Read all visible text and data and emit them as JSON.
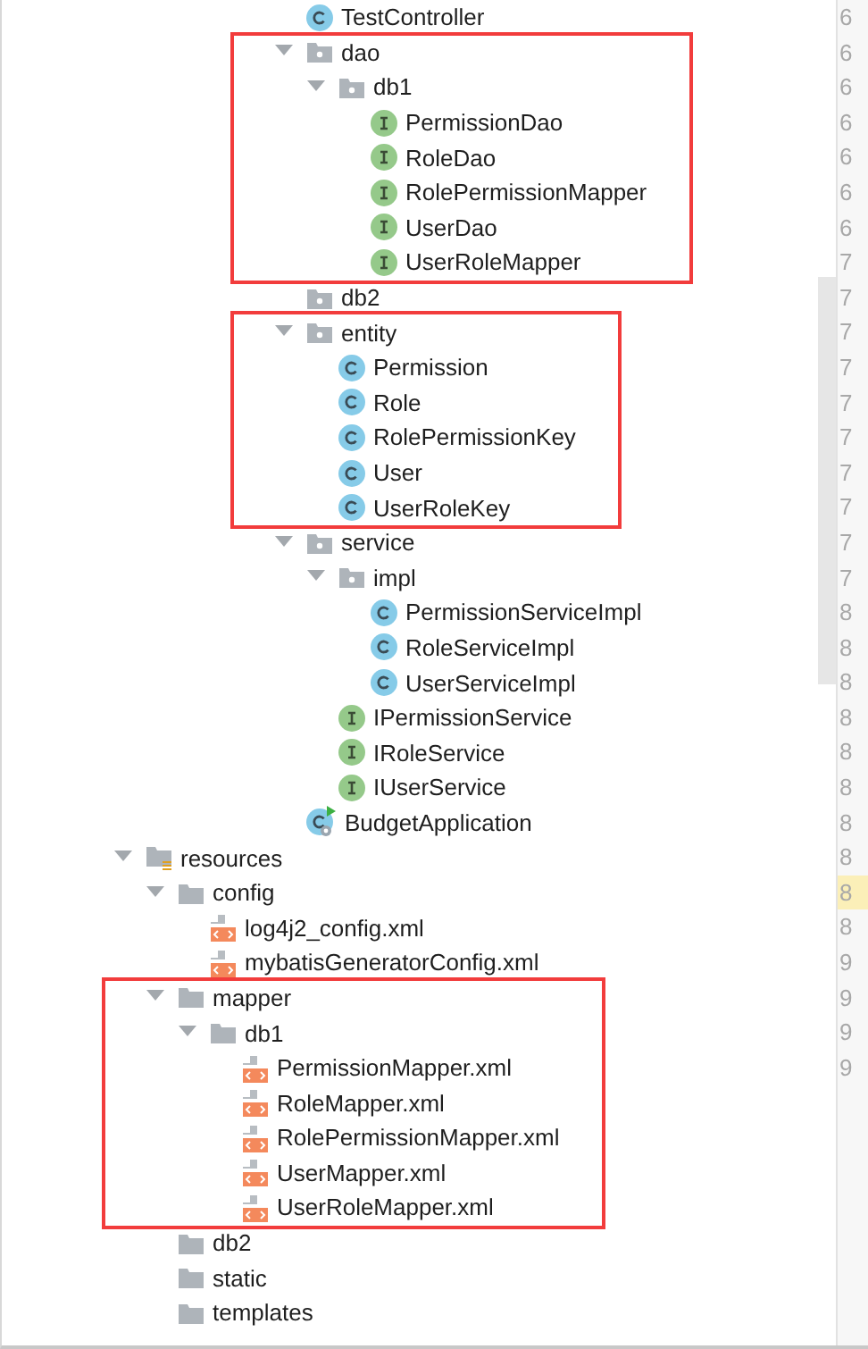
{
  "tree": {
    "package_contents": [
      {
        "children": [
          {
            "name": "TestController",
            "kind": "class"
          }
        ]
      },
      {
        "name": "dao",
        "kind": "package",
        "expanded": true,
        "boxed": true,
        "children": [
          {
            "name": "db1",
            "kind": "package",
            "expanded": true,
            "children": [
              {
                "name": "PermissionDao",
                "kind": "interface"
              },
              {
                "name": "RoleDao",
                "kind": "interface"
              },
              {
                "name": "RolePermissionMapper",
                "kind": "interface"
              },
              {
                "name": "UserDao",
                "kind": "interface"
              },
              {
                "name": "UserRoleMapper",
                "kind": "interface"
              }
            ]
          }
        ]
      },
      {
        "children": [
          {
            "name": "db2",
            "kind": "package"
          }
        ]
      },
      {
        "name": "entity",
        "kind": "package",
        "expanded": true,
        "boxed": true,
        "children": [
          {
            "name": "Permission",
            "kind": "class"
          },
          {
            "name": "Role",
            "kind": "class"
          },
          {
            "name": "RolePermissionKey",
            "kind": "class"
          },
          {
            "name": "User",
            "kind": "class"
          },
          {
            "name": "UserRoleKey",
            "kind": "class"
          }
        ]
      },
      {
        "name": "service",
        "kind": "package",
        "expanded": true,
        "children": [
          {
            "name": "impl",
            "kind": "package",
            "expanded": true,
            "children": [
              {
                "name": "PermissionServiceImpl",
                "kind": "class"
              },
              {
                "name": "RoleServiceImpl",
                "kind": "class"
              },
              {
                "name": "UserServiceImpl",
                "kind": "class"
              }
            ]
          },
          {
            "name": "IPermissionService",
            "kind": "interface"
          },
          {
            "name": "IRoleService",
            "kind": "interface"
          },
          {
            "name": "IUserService",
            "kind": "interface"
          }
        ]
      },
      {
        "name": "BudgetApplication",
        "kind": "application"
      }
    ],
    "nodes": [
      {
        "name": "resources",
        "kind": "resources",
        "expanded": true,
        "children": [
          {
            "name": "config",
            "kind": "folder",
            "expanded": true,
            "children": [
              {
                "name": "log4j2_config.xml",
                "kind": "xml"
              },
              {
                "name": "mybatisGeneratorConfig.xml",
                "kind": "xml"
              }
            ]
          },
          {
            "name": "mapper",
            "kind": "folder",
            "expanded": true,
            "boxed": true,
            "children": [
              {
                "name": "db1",
                "kind": "folder",
                "expanded": true,
                "children": [
                  {
                    "name": "PermissionMapper.xml",
                    "kind": "xml"
                  },
                  {
                    "name": "RoleMapper.xml",
                    "kind": "xml"
                  },
                  {
                    "name": "RolePermissionMapper.xml",
                    "kind": "xml"
                  },
                  {
                    "name": "UserMapper.xml",
                    "kind": "xml"
                  },
                  {
                    "name": "UserRoleMapper.xml",
                    "kind": "xml"
                  }
                ]
              }
            ]
          },
          {
            "children": [
              {
                "name": "db2",
                "kind": "folder"
              }
            ]
          },
          {
            "name": "static",
            "kind": "folder"
          },
          {
            "name": "templates",
            "kind": "folder"
          }
        ]
      }
    ]
  },
  "line_numbers": [
    {
      "text": "6",
      "current": false
    },
    {
      "text": "6",
      "current": false
    },
    {
      "text": "6",
      "current": false
    },
    {
      "text": "6",
      "current": false
    },
    {
      "text": "6",
      "current": false
    },
    {
      "text": "6",
      "current": false
    },
    {
      "text": "6",
      "current": false
    },
    {
      "text": "7",
      "current": false
    },
    {
      "text": "7",
      "current": false
    },
    {
      "text": "7",
      "current": false
    },
    {
      "text": "7",
      "current": false
    },
    {
      "text": "7",
      "current": false
    },
    {
      "text": "7",
      "current": false
    },
    {
      "text": "7",
      "current": false
    },
    {
      "text": "7",
      "current": false
    },
    {
      "text": "7",
      "current": false
    },
    {
      "text": "7",
      "current": false
    },
    {
      "text": "8",
      "current": false
    },
    {
      "text": "8",
      "current": false
    },
    {
      "text": "8",
      "current": false
    },
    {
      "text": "8",
      "current": false
    },
    {
      "text": "8",
      "current": false
    },
    {
      "text": "8",
      "current": false
    },
    {
      "text": "8",
      "current": false
    },
    {
      "text": "8",
      "current": false
    },
    {
      "text": "8",
      "current": true
    },
    {
      "text": "8",
      "current": false
    },
    {
      "text": "9",
      "current": false
    },
    {
      "text": "9",
      "current": false
    },
    {
      "text": "9",
      "current": false
    },
    {
      "text": "9",
      "current": false
    }
  ]
}
